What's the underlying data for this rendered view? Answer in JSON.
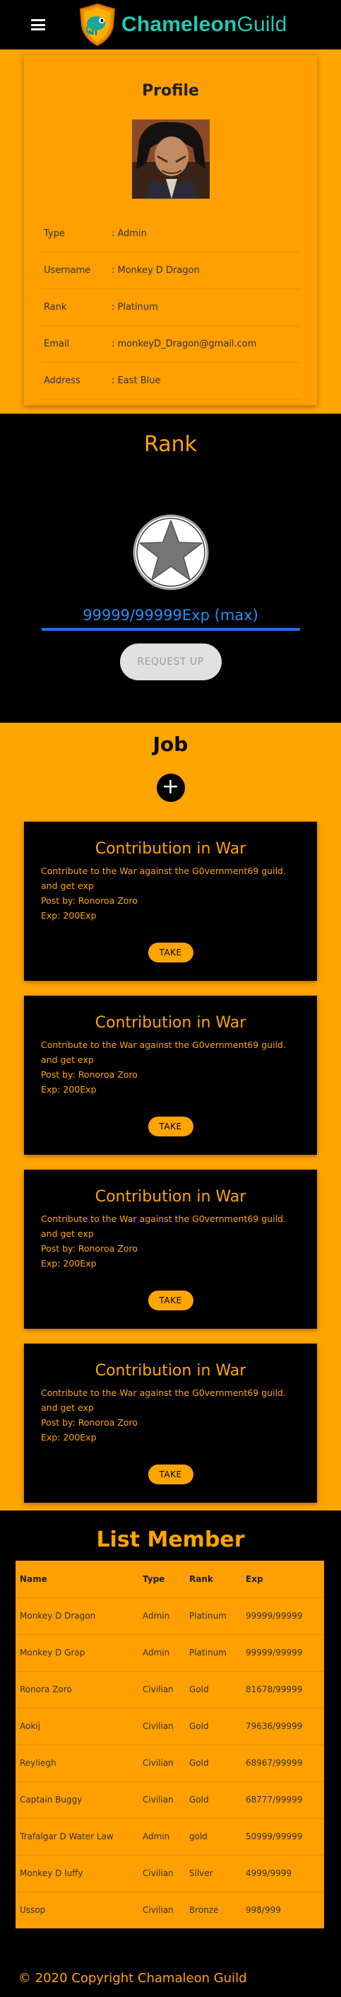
{
  "navbar": {
    "brand_bold": "Chameleon",
    "brand_light": "Guild"
  },
  "profile": {
    "title": "Profile",
    "rows": [
      {
        "key": "Type",
        "value": ": Admin"
      },
      {
        "key": "Username",
        "value": ": Monkey D Dragon"
      },
      {
        "key": "Rank",
        "value": ": Platinum"
      },
      {
        "key": "Email",
        "value": ": monkeyD_Dragon@gmail.com"
      },
      {
        "key": "Address",
        "value": ": East Blue"
      }
    ]
  },
  "rank": {
    "title": "Rank",
    "exp_text": "99999/99999Exp (max)",
    "exp_progress": 1.0,
    "request_label": "REQUEST UP"
  },
  "job": {
    "title": "Job",
    "add_label": "+",
    "cards": [
      {
        "title": "Contribution in War",
        "desc": "Contribute to the War against the G0vernment69 guild. and get exp",
        "poster": "Post by: Ronoroa Zoro",
        "exp": "Exp: 200Exp",
        "button": "TAKE"
      },
      {
        "title": "Contribution in War",
        "desc": "Contribute to the War against the G0vernment69 guild. and get exp",
        "poster": "Post by: Ronoroa Zoro",
        "exp": "Exp: 200Exp",
        "button": "TAKE"
      },
      {
        "title": "Contribution in War",
        "desc": "Contribute to the War against the G0vernment69 guild. and get exp",
        "poster": "Post by: Ronoroa Zoro",
        "exp": "Exp: 200Exp",
        "button": "TAKE"
      },
      {
        "title": "Contribution in War",
        "desc": "Contribute to the War against the G0vernment69 guild. and get exp",
        "poster": "Post by: Ronoroa Zoro",
        "exp": "Exp: 200Exp",
        "button": "TAKE"
      }
    ]
  },
  "members": {
    "title": "List Member",
    "headers": [
      "Name",
      "Type",
      "Rank",
      "Exp"
    ],
    "rows": [
      [
        "Monkey D Dragon",
        "Admin",
        "Platinum",
        "99999/99999"
      ],
      [
        "Monkey D Grap",
        "Admin",
        "Platinum",
        "99999/99999"
      ],
      [
        "Ronora Zoro",
        "Civilian",
        "Gold",
        "81678/99999"
      ],
      [
        "Aokij",
        "Civilian",
        "Gold",
        "79636/99999"
      ],
      [
        "Reyliegh",
        "Civilian",
        "Gold",
        "68967/99999"
      ],
      [
        "Captain Buggy",
        "Civilian",
        "Gold",
        "68777/99999"
      ],
      [
        "Trafalgar D Water Law",
        "Admin",
        "gold",
        "50999/99999"
      ],
      [
        "Monkey D luffy",
        "Civilian",
        "Silver",
        "4999/9999"
      ],
      [
        "Ussop",
        "Civilian",
        "Bronze",
        "998/999"
      ]
    ]
  },
  "footer": {
    "text": "© 2020 Copyright Chamaleon Guild"
  },
  "colors": {
    "orange": "#ffa500",
    "teal": "#20c9b6",
    "blue": "#1e90ff"
  }
}
